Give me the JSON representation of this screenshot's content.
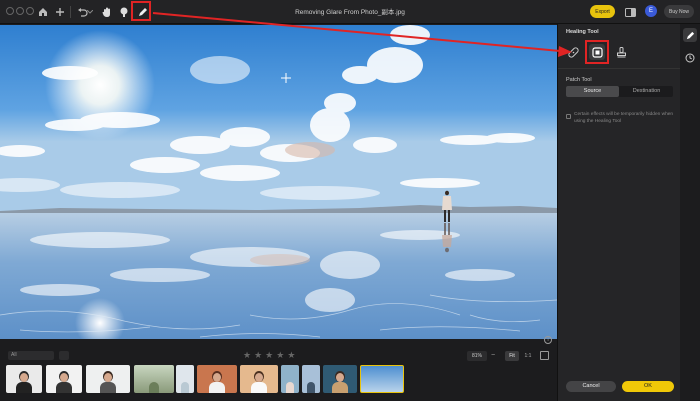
{
  "window": {
    "title": "Removing Glare From Photo_副本.jpg"
  },
  "toolbar": {
    "icons": [
      "home-icon",
      "plus-icon",
      "undo-icon",
      "hand-icon",
      "mask-icon",
      "pencil-icon"
    ]
  },
  "header": {
    "export_label": "Export",
    "user_initial": "E",
    "buy_label": "Buy Now"
  },
  "panel": {
    "title": "Healing Tool",
    "tools": [
      "bandage-icon",
      "patch-icon",
      "stamp-icon"
    ],
    "patch_label": "Patch Tool",
    "modes": [
      "Source",
      "Destination"
    ],
    "active_mode": "Source",
    "note": "Certain effects will be temporarily hidden when using the Healing Tool",
    "note_checked": false,
    "cancel_label": "Cancel",
    "ok_label": "OK"
  },
  "bottom": {
    "filter_value": "All",
    "rating": 0,
    "stars": 5,
    "zoom": "81%",
    "zoom_minus": "−",
    "fit_label": "Fit",
    "ratio_label": "1:1"
  },
  "colors": {
    "accent": "#f0c808",
    "highlight": "#e02424",
    "panel_bg": "#252527"
  }
}
